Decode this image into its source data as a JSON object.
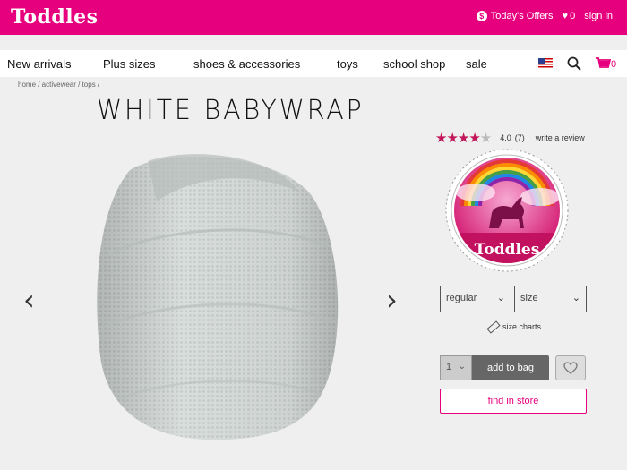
{
  "header": {
    "logo": "Toddles",
    "offers_label": "Today's Offers",
    "offers_icon": "dollar-coin-icon",
    "wishlist_count": "0",
    "signin_label": "sign in",
    "brand_color": "#e6007e"
  },
  "nav": {
    "items": [
      "New arrivals",
      "Plus sizes",
      "shoes & accessories",
      "toys",
      "school shop",
      "sale"
    ],
    "cart_count": "0"
  },
  "breadcrumb": "home / activewear / tops /",
  "product": {
    "title": "WHITE BABYWRAP",
    "rating_value": "4.0",
    "rating_count": "(7)",
    "stars": 4,
    "stars_max": 5,
    "write_review": "write a review",
    "badge_logo": "Toddles",
    "fit_select": "regular",
    "size_select": "size",
    "size_charts": "size charts",
    "quantity": "1",
    "add_to_bag": "add to bag",
    "find_in_store": "find in store"
  }
}
